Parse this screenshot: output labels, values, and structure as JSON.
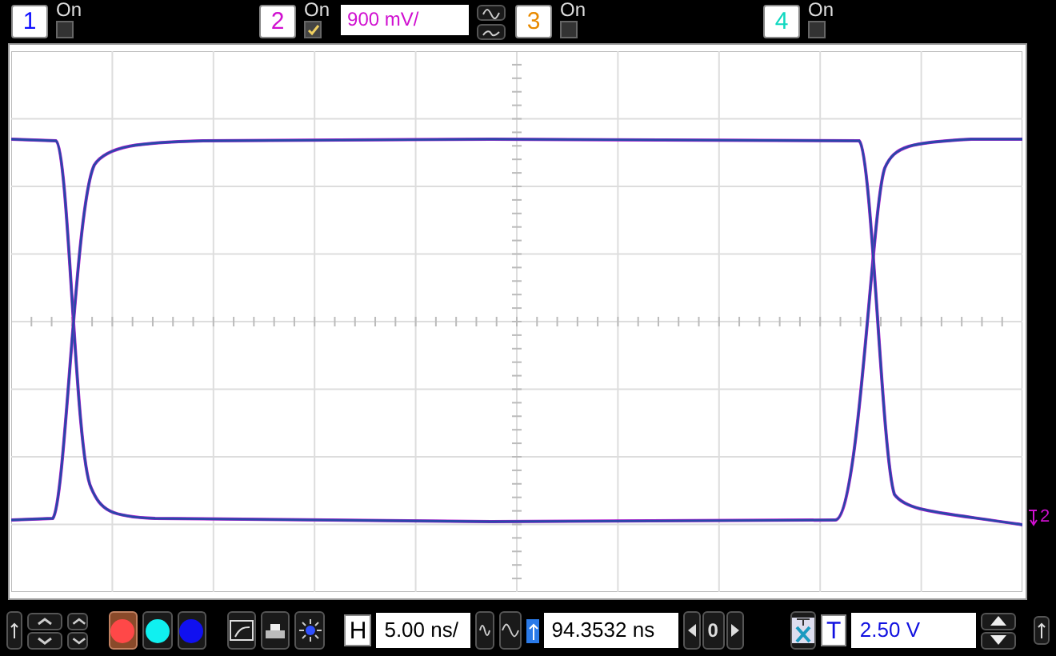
{
  "channels": [
    {
      "number": "1",
      "color": "#1010ff",
      "on_label": "On",
      "on": false
    },
    {
      "number": "2",
      "color": "#d010d0",
      "on_label": "On",
      "on": true,
      "scale": "900 mV/"
    },
    {
      "number": "3",
      "color": "#e88a00",
      "on_label": "On",
      "on": false
    },
    {
      "number": "4",
      "color": "#10d8c0",
      "on_label": "On",
      "on": false
    }
  ],
  "plot": {
    "trace_marker": "2"
  },
  "toolbar": {
    "swatches": [
      {
        "color": "#ff4848",
        "selected": true
      },
      {
        "color": "#10f0f0",
        "selected": false
      },
      {
        "color": "#1010f0",
        "selected": false
      }
    ],
    "horizontal": {
      "label": "H",
      "scale": "5.00 ns/",
      "position": "94.3532 ns",
      "index": "0"
    },
    "trigger": {
      "label": "T",
      "threshold": "2.50 V"
    }
  }
}
